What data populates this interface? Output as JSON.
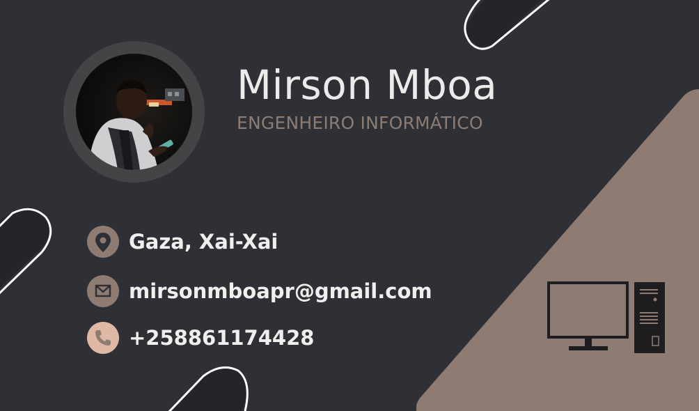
{
  "profile": {
    "name": "Mirson Mboa",
    "title": "ENGENHEIRO INFORMÁTICO"
  },
  "contacts": [
    {
      "icon": "location-pin-icon",
      "text": "Gaza, Xai-Xai"
    },
    {
      "icon": "envelope-icon",
      "text": "mirsonmboapr@gmail.com"
    },
    {
      "icon": "phone-icon",
      "text": "+258861174428"
    }
  ],
  "colors": {
    "background": "#2e3036",
    "accent": "#8e7c73",
    "icon_fill": "#e0b9a6",
    "text": "#f0efee"
  }
}
